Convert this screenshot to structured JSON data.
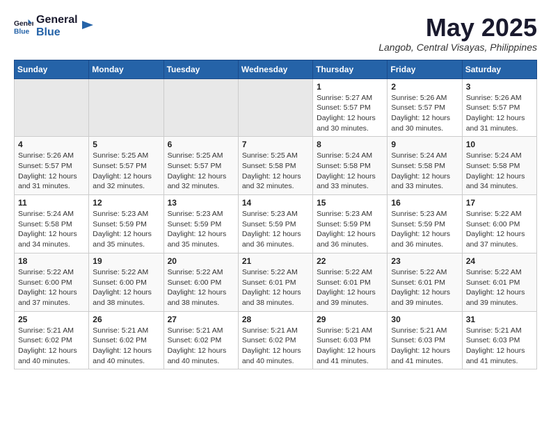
{
  "app": {
    "logo_general": "General",
    "logo_blue": "Blue"
  },
  "title": {
    "month_year": "May 2025",
    "location": "Langob, Central Visayas, Philippines"
  },
  "calendar": {
    "headers": [
      "Sunday",
      "Monday",
      "Tuesday",
      "Wednesday",
      "Thursday",
      "Friday",
      "Saturday"
    ],
    "weeks": [
      {
        "bg": "row-bg-1",
        "days": [
          {
            "num": "",
            "info": "",
            "empty": true
          },
          {
            "num": "",
            "info": "",
            "empty": true
          },
          {
            "num": "",
            "info": "",
            "empty": true
          },
          {
            "num": "",
            "info": "",
            "empty": true
          },
          {
            "num": "1",
            "info": "Sunrise: 5:27 AM\nSunset: 5:57 PM\nDaylight: 12 hours\nand 30 minutes.",
            "empty": false
          },
          {
            "num": "2",
            "info": "Sunrise: 5:26 AM\nSunset: 5:57 PM\nDaylight: 12 hours\nand 30 minutes.",
            "empty": false
          },
          {
            "num": "3",
            "info": "Sunrise: 5:26 AM\nSunset: 5:57 PM\nDaylight: 12 hours\nand 31 minutes.",
            "empty": false
          }
        ]
      },
      {
        "bg": "row-bg-2",
        "days": [
          {
            "num": "4",
            "info": "Sunrise: 5:26 AM\nSunset: 5:57 PM\nDaylight: 12 hours\nand 31 minutes.",
            "empty": false
          },
          {
            "num": "5",
            "info": "Sunrise: 5:25 AM\nSunset: 5:57 PM\nDaylight: 12 hours\nand 32 minutes.",
            "empty": false
          },
          {
            "num": "6",
            "info": "Sunrise: 5:25 AM\nSunset: 5:57 PM\nDaylight: 12 hours\nand 32 minutes.",
            "empty": false
          },
          {
            "num": "7",
            "info": "Sunrise: 5:25 AM\nSunset: 5:58 PM\nDaylight: 12 hours\nand 32 minutes.",
            "empty": false
          },
          {
            "num": "8",
            "info": "Sunrise: 5:24 AM\nSunset: 5:58 PM\nDaylight: 12 hours\nand 33 minutes.",
            "empty": false
          },
          {
            "num": "9",
            "info": "Sunrise: 5:24 AM\nSunset: 5:58 PM\nDaylight: 12 hours\nand 33 minutes.",
            "empty": false
          },
          {
            "num": "10",
            "info": "Sunrise: 5:24 AM\nSunset: 5:58 PM\nDaylight: 12 hours\nand 34 minutes.",
            "empty": false
          }
        ]
      },
      {
        "bg": "row-bg-1",
        "days": [
          {
            "num": "11",
            "info": "Sunrise: 5:24 AM\nSunset: 5:58 PM\nDaylight: 12 hours\nand 34 minutes.",
            "empty": false
          },
          {
            "num": "12",
            "info": "Sunrise: 5:23 AM\nSunset: 5:59 PM\nDaylight: 12 hours\nand 35 minutes.",
            "empty": false
          },
          {
            "num": "13",
            "info": "Sunrise: 5:23 AM\nSunset: 5:59 PM\nDaylight: 12 hours\nand 35 minutes.",
            "empty": false
          },
          {
            "num": "14",
            "info": "Sunrise: 5:23 AM\nSunset: 5:59 PM\nDaylight: 12 hours\nand 36 minutes.",
            "empty": false
          },
          {
            "num": "15",
            "info": "Sunrise: 5:23 AM\nSunset: 5:59 PM\nDaylight: 12 hours\nand 36 minutes.",
            "empty": false
          },
          {
            "num": "16",
            "info": "Sunrise: 5:23 AM\nSunset: 5:59 PM\nDaylight: 12 hours\nand 36 minutes.",
            "empty": false
          },
          {
            "num": "17",
            "info": "Sunrise: 5:22 AM\nSunset: 6:00 PM\nDaylight: 12 hours\nand 37 minutes.",
            "empty": false
          }
        ]
      },
      {
        "bg": "row-bg-2",
        "days": [
          {
            "num": "18",
            "info": "Sunrise: 5:22 AM\nSunset: 6:00 PM\nDaylight: 12 hours\nand 37 minutes.",
            "empty": false
          },
          {
            "num": "19",
            "info": "Sunrise: 5:22 AM\nSunset: 6:00 PM\nDaylight: 12 hours\nand 38 minutes.",
            "empty": false
          },
          {
            "num": "20",
            "info": "Sunrise: 5:22 AM\nSunset: 6:00 PM\nDaylight: 12 hours\nand 38 minutes.",
            "empty": false
          },
          {
            "num": "21",
            "info": "Sunrise: 5:22 AM\nSunset: 6:01 PM\nDaylight: 12 hours\nand 38 minutes.",
            "empty": false
          },
          {
            "num": "22",
            "info": "Sunrise: 5:22 AM\nSunset: 6:01 PM\nDaylight: 12 hours\nand 39 minutes.",
            "empty": false
          },
          {
            "num": "23",
            "info": "Sunrise: 5:22 AM\nSunset: 6:01 PM\nDaylight: 12 hours\nand 39 minutes.",
            "empty": false
          },
          {
            "num": "24",
            "info": "Sunrise: 5:22 AM\nSunset: 6:01 PM\nDaylight: 12 hours\nand 39 minutes.",
            "empty": false
          }
        ]
      },
      {
        "bg": "row-bg-1",
        "days": [
          {
            "num": "25",
            "info": "Sunrise: 5:21 AM\nSunset: 6:02 PM\nDaylight: 12 hours\nand 40 minutes.",
            "empty": false
          },
          {
            "num": "26",
            "info": "Sunrise: 5:21 AM\nSunset: 6:02 PM\nDaylight: 12 hours\nand 40 minutes.",
            "empty": false
          },
          {
            "num": "27",
            "info": "Sunrise: 5:21 AM\nSunset: 6:02 PM\nDaylight: 12 hours\nand 40 minutes.",
            "empty": false
          },
          {
            "num": "28",
            "info": "Sunrise: 5:21 AM\nSunset: 6:02 PM\nDaylight: 12 hours\nand 40 minutes.",
            "empty": false
          },
          {
            "num": "29",
            "info": "Sunrise: 5:21 AM\nSunset: 6:03 PM\nDaylight: 12 hours\nand 41 minutes.",
            "empty": false
          },
          {
            "num": "30",
            "info": "Sunrise: 5:21 AM\nSunset: 6:03 PM\nDaylight: 12 hours\nand 41 minutes.",
            "empty": false
          },
          {
            "num": "31",
            "info": "Sunrise: 5:21 AM\nSunset: 6:03 PM\nDaylight: 12 hours\nand 41 minutes.",
            "empty": false
          }
        ]
      }
    ]
  }
}
